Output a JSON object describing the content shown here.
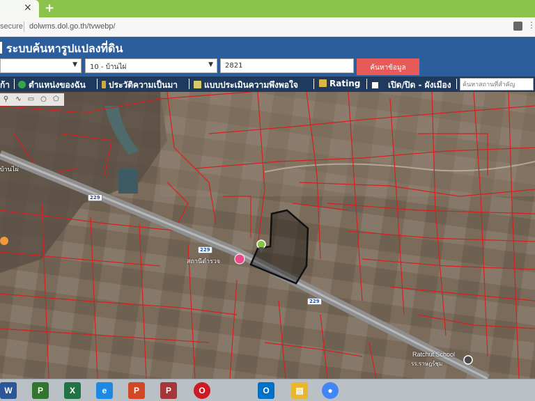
{
  "browser": {
    "close_glyph": "×",
    "new_tab_glyph": "+",
    "security_label": "secure",
    "url": "dolwms.dol.go.th/tvwebp/",
    "menu_glyph": "⋮"
  },
  "header": {
    "title": "ระบบค้นหารูปแปลงที่ดิน"
  },
  "search": {
    "amphoe_value": "",
    "tambon_value": "10 - บ้านไผ่",
    "parcel_value": "2821",
    "submit_label": "ค้นหาข้อมูล",
    "arrow_glyph": "▼"
  },
  "nav": {
    "items": [
      {
        "label": "ก้า",
        "icon": "home-icon"
      },
      {
        "label": "ตำแหน่งของฉัน",
        "icon": "location-icon"
      },
      {
        "label": "ประวัติความเป็นมา",
        "icon": "history-icon"
      },
      {
        "label": "แบบประเมินความพึงพอใจ",
        "icon": "survey-icon"
      },
      {
        "label": "Rating",
        "icon": "rating-icon"
      },
      {
        "label": "เปิด/ปิด - ผังเมือง",
        "icon": "checkbox-icon"
      }
    ],
    "place_search_placeholder": "ค้นหาสถานที่สำคัญ"
  },
  "map": {
    "tools": [
      "pin-tool",
      "line-tool",
      "rect-tool",
      "circle-tool",
      "polygon-tool"
    ],
    "tool_glyphs": [
      "⚲",
      "∿",
      "▭",
      "○",
      "⬠"
    ],
    "labels": {
      "road_shield": "229",
      "town_label": "บ้านไผ่",
      "station_label": "สถานีตำรวจ",
      "school_label": "Ratchut School",
      "school_label_th": "รร.ราษฎร์ชุม"
    },
    "colors": {
      "parcel_line": "#d6201f",
      "selected_parcel": "#111111",
      "road": "#9b9b9b"
    }
  },
  "taskbar": {
    "apps": [
      {
        "name": "word",
        "glyph": "W",
        "color": "#2b579a"
      },
      {
        "name": "project",
        "glyph": "P",
        "color": "#31752f"
      },
      {
        "name": "excel",
        "glyph": "X",
        "color": "#217346"
      },
      {
        "name": "edge",
        "glyph": "e",
        "color": "#1e88e5"
      },
      {
        "name": "powerpoint",
        "glyph": "P",
        "color": "#d24726"
      },
      {
        "name": "publisher",
        "glyph": "P",
        "color": "#a4373a"
      },
      {
        "name": "opera",
        "glyph": "O",
        "color": "#cc1b24"
      },
      {
        "name": "outlook",
        "glyph": "O",
        "color": "#0072c6"
      },
      {
        "name": "explorer",
        "glyph": "▤",
        "color": "#e8b730"
      },
      {
        "name": "chrome",
        "glyph": "●",
        "color": "#4285f4"
      }
    ]
  }
}
